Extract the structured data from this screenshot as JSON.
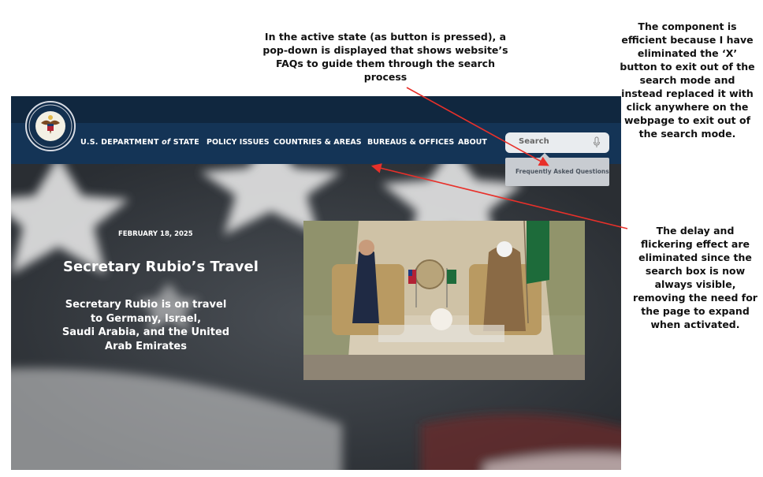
{
  "annotations": {
    "top": "In the active state (as button is pressed), a pop-down is displayed that shows website’s FAQs to guide them through the search process",
    "right_top": "The component is efficient because I have eliminated the ‘X’ button to exit out of the search mode and instead replaced it with click anywhere on the webpage to exit out of the search mode.",
    "right_mid": "The delay and flickering effect are eliminated since the search box is now always visible, removing the need for the page to expand when activated."
  },
  "header": {
    "brand_prefix": "U.S. DEPARTMENT ",
    "brand_of": "of",
    "brand_suffix": " STATE",
    "nav": [
      "POLICY ISSUES",
      "COUNTRIES & AREAS",
      "BUREAUS & OFFICES",
      "ABOUT"
    ],
    "search": {
      "placeholder": "Search",
      "icon": "microphone-icon"
    },
    "dropdown": {
      "item": "Frequently Asked Questions"
    }
  },
  "hero": {
    "date": "FEBRUARY 18, 2025",
    "title": "Secretary Rubio’s Travel",
    "description": "Secretary Rubio is on travel to Germany, Israel,\nSaudi Arabia, and the United Arab Emirates"
  },
  "colors": {
    "topbar": "#10273f",
    "navbar": "#143456",
    "arrow": "#e8302a",
    "search_bg": "#e9ecef",
    "dropdown_bg": "#c8ccd1"
  }
}
